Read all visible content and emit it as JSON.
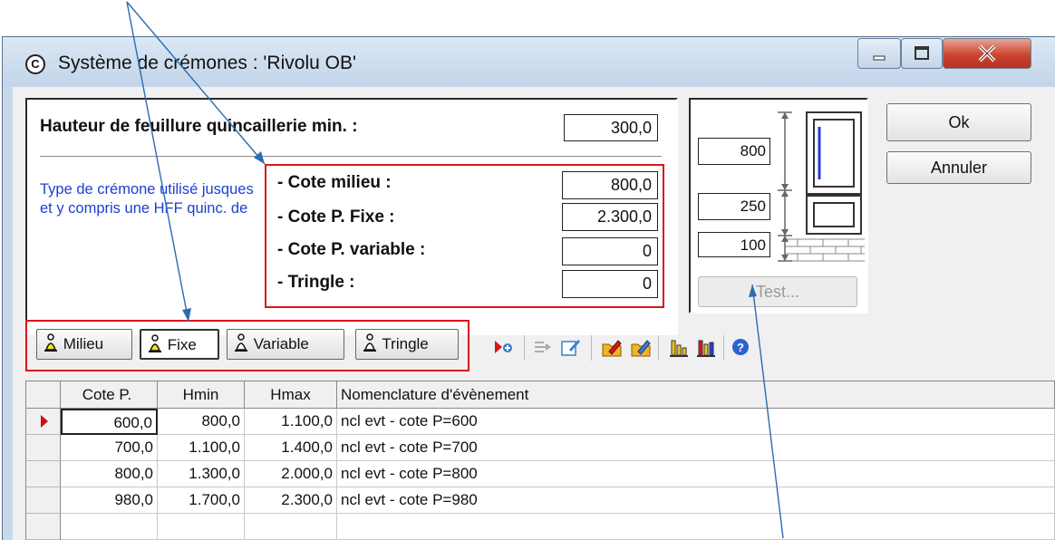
{
  "window": {
    "title": "Système de crémones : 'Rivolu OB'",
    "app_icon": "circle-c-icon",
    "controls": [
      "minimize-icon",
      "maximize-icon",
      "close-icon"
    ]
  },
  "form": {
    "hauteur_label": "Hauteur de feuillure quincaillerie min. :",
    "hauteur_value": "300,0",
    "note": "Type de crémone utilisé jusques et y compris une HFF quinc. de",
    "cotes": [
      {
        "label": "- Cote milieu :",
        "value": "800,0"
      },
      {
        "label": "- Cote P. Fixe :",
        "value": "2.300,0"
      },
      {
        "label": "- Cote P. variable :",
        "value": "0"
      },
      {
        "label": "- Tringle :",
        "value": "0"
      }
    ]
  },
  "preview": {
    "v1": "800",
    "v2": "250",
    "v3": "100",
    "test_label": "Test..."
  },
  "buttons": {
    "ok": "Ok",
    "cancel": "Annuler"
  },
  "type_buttons": [
    {
      "label": "Milieu",
      "active": false
    },
    {
      "label": "Fixe",
      "active": true
    },
    {
      "label": "Variable",
      "active": false
    },
    {
      "label": "Tringle",
      "active": false
    }
  ],
  "toolbar_icons": [
    "insert-row-icon",
    "move-icon",
    "edit-icon",
    "folder-edit-icon",
    "folder-export-icon",
    "chart-bars-icon",
    "chart-color-icon",
    "help-icon"
  ],
  "grid": {
    "headers": [
      "Cote P.",
      "Hmin",
      "Hmax",
      "Nomenclature d'évènement"
    ],
    "rows": [
      [
        "600,0",
        "800,0",
        "1.100,0",
        "ncl evt - cote P=600"
      ],
      [
        "700,0",
        "1.100,0",
        "1.400,0",
        "ncl evt - cote P=700"
      ],
      [
        "800,0",
        "1.300,0",
        "2.000,0",
        "ncl evt - cote P=800"
      ],
      [
        "980,0",
        "1.700,0",
        "2.300,0",
        "ncl evt - cote P=980"
      ]
    ]
  },
  "colors": {
    "annotation_red": "#d9151c",
    "annotation_arrow": "#2b6cb0",
    "note_blue": "#1a3fd1"
  }
}
